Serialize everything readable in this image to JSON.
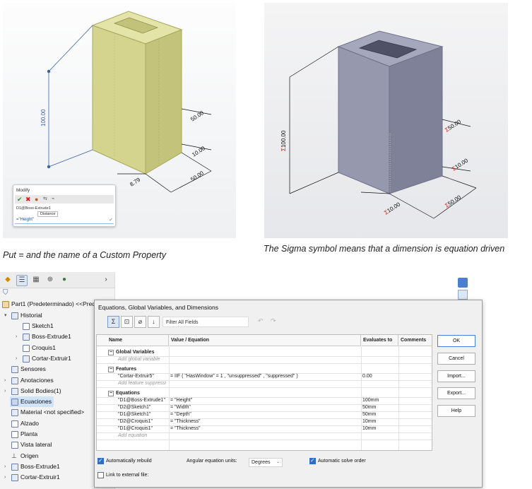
{
  "captions": {
    "left": "Put = and the name of a Custom Property",
    "right": "The Sigma symbol means that a dimension is equation driven"
  },
  "left_model": {
    "dims": [
      "100.00",
      "50.00",
      "10.00",
      "50.00",
      "8.79"
    ],
    "modify": {
      "title": "Modify",
      "dim_name": "D1@Boss-Extrude1",
      "tooltip": "Distance",
      "value": "=\"Height\""
    }
  },
  "right_model": {
    "dims": [
      "100.00",
      "50.00",
      "10.00",
      "50.00",
      "10.00"
    ],
    "sigma": "Σ"
  },
  "tree": {
    "part": "Part1 (Predeterminado) <<Prede",
    "items": [
      "Historial",
      "Sketch1",
      "Boss-Extrude1",
      "Croquis1",
      "Cortar-Extruir1",
      "Sensores",
      "Anotaciones",
      "Solid Bodies(1)",
      "Ecuaciones",
      "Material <not specified>",
      "Alzado",
      "Planta",
      "Vista lateral",
      "Origen",
      "Boss-Extrude1",
      "Cortar-Extruir1"
    ]
  },
  "dialog": {
    "title": "Equations, Global Variables, and Dimensions",
    "filter_placeholder": "Filter All Fields",
    "columns": [
      "Name",
      "Value / Equation",
      "Evaluates to",
      "Comments"
    ],
    "sections": {
      "global": "Global Variables",
      "global_add": "Add global variable",
      "features": "Features",
      "features_add": "Add feature suppressi",
      "equations": "Equations",
      "equations_add": "Add equation"
    },
    "feature_row": {
      "name": "\"Cortar-Extruir5\"",
      "value": "= IIF ( \"HasWindow\" = 1 , \"unsuppressed\" , \"suppressed\" )",
      "eval": "0.00"
    },
    "equations": [
      {
        "name": "\"D1@Boss-Extrude1\"",
        "value": "= \"Height\"",
        "eval": "100mm"
      },
      {
        "name": "\"D2@Sketch1\"",
        "value": "= \"Width\"",
        "eval": "50mm"
      },
      {
        "name": "\"D1@Sketch1\"",
        "value": "= \"Depth\"",
        "eval": "50mm"
      },
      {
        "name": "\"D2@Croquis1\"",
        "value": "= \"Thickness\"",
        "eval": "10mm"
      },
      {
        "name": "\"D1@Croquis1\"",
        "value": "= \"Thickness\"",
        "eval": "10mm"
      }
    ],
    "buttons": [
      "OK",
      "Cancel",
      "Import...",
      "Export...",
      "Help"
    ],
    "auto_rebuild": "Automatically rebuild",
    "angular_label": "Angular equation units:",
    "angular_value": "Degrees",
    "auto_solve": "Automatic solve order",
    "link_external": "Link to external file:"
  },
  "colors": {
    "yellow_face": "#d4d48f",
    "gray_face": "#9a9db4",
    "sigma_red": "#d12020",
    "accent": "#2f6ec8"
  }
}
